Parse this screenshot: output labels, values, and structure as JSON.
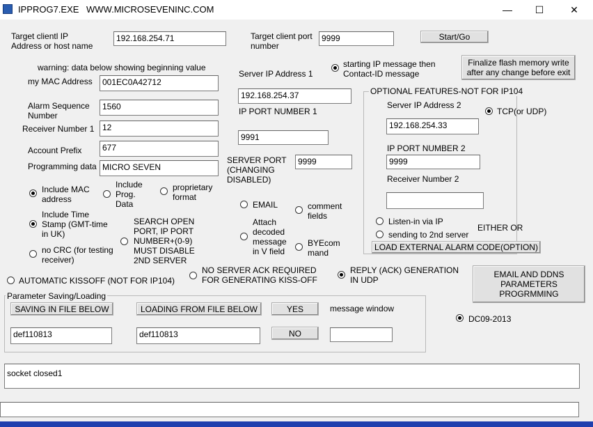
{
  "window": {
    "title": "IPPROG7.EXE",
    "url": "WWW.MICROSEVENINC.COM",
    "minimize": "—",
    "maximize": "☐",
    "close": "✕"
  },
  "target": {
    "client_ip_label": "Target clientl IP\nAddress or host name",
    "client_ip_value": "192.168.254.71",
    "client_port_label": "Target client port\nnumber",
    "client_port_value": "9999",
    "start_button": "Start/Go"
  },
  "warning": "warning: data below showing beginning value",
  "device": {
    "mac_label": "my MAC Address",
    "mac_value": "001EC0A42712",
    "alarm_seq_label": "Alarm Sequence\nNumber",
    "alarm_seq_value": "1560",
    "receiver_label": "Receiver Number 1",
    "receiver_value": "12",
    "account_label": "Account Prefix",
    "account_value": "677",
    "prog_label": "Programming data",
    "prog_value": "MICRO SEVEN"
  },
  "server1": {
    "ip_label": "Server IP Address 1",
    "ip_value": "192.168.254.37",
    "port_label": "IP PORT NUMBER 1",
    "port_value": "9991",
    "server_port_label": "SERVER PORT\n(CHANGING\nDISABLED)",
    "server_port_value": "9999"
  },
  "message_option": "starting IP message then\nContact-ID message",
  "finalize_button": "Finalize flash memory write\nafter any change before exit",
  "optional": {
    "title": "OPTIONAL FEATURES-NOT FOR IP104",
    "ip2_label": "Server IP Address 2",
    "ip2_value": "192.168.254.33",
    "tcp_label": "TCP(or UDP)",
    "port2_label": "IP PORT NUMBER 2",
    "port2_value": "9999",
    "receiver2_label": "Receiver Number 2",
    "receiver2_value": "",
    "listen_label": "Listen-in via IP",
    "second_label": "sending to 2nd server",
    "either_or": "EITHER OR",
    "load_button": "LOAD EXTERNAL ALARM CODE(OPTION)"
  },
  "options": {
    "include_mac": "Include MAC\naddress",
    "include_prog": "Include\nProg.\nData",
    "proprietary": "proprietary\nformat",
    "timestamp": "Include Time\nStamp (GMT-time\nin UK)",
    "search_port": "SEARCH OPEN\nPORT, IP PORT\nNUMBER+(0-9)\nMUST DISABLE\n2ND SERVER",
    "no_crc": "no CRC (for testing\nreceiver)",
    "email": "EMAIL",
    "comment": "comment\nfields",
    "attach": "Attach\ndecoded\nmessage\nin V field",
    "byecom": "BYEcom\nmand",
    "auto_kissoff": "AUTOMATIC KISSOFF (NOT FOR IP104)",
    "no_ack": "NO SERVER ACK REQUIRED\nFOR GENERATING KISS-OFF",
    "reply_ack": "REPLY (ACK) GENERATION\nIN UDP"
  },
  "email_button": "EMAIL AND DDNS\nPARAMETERS\nPROGRMMING",
  "params": {
    "title": "Parameter Saving/Loading",
    "save_button": "SAVING IN FILE BELOW",
    "save_value": "def110813",
    "load_button": "LOADING FROM FILE BELOW",
    "load_value": "def110813",
    "yes_button": "YES",
    "no_button": "NO",
    "message_label": "message window",
    "message_value": ""
  },
  "dc_label": "DC09-2013",
  "status_text": "socket closed1",
  "status_text2": ""
}
